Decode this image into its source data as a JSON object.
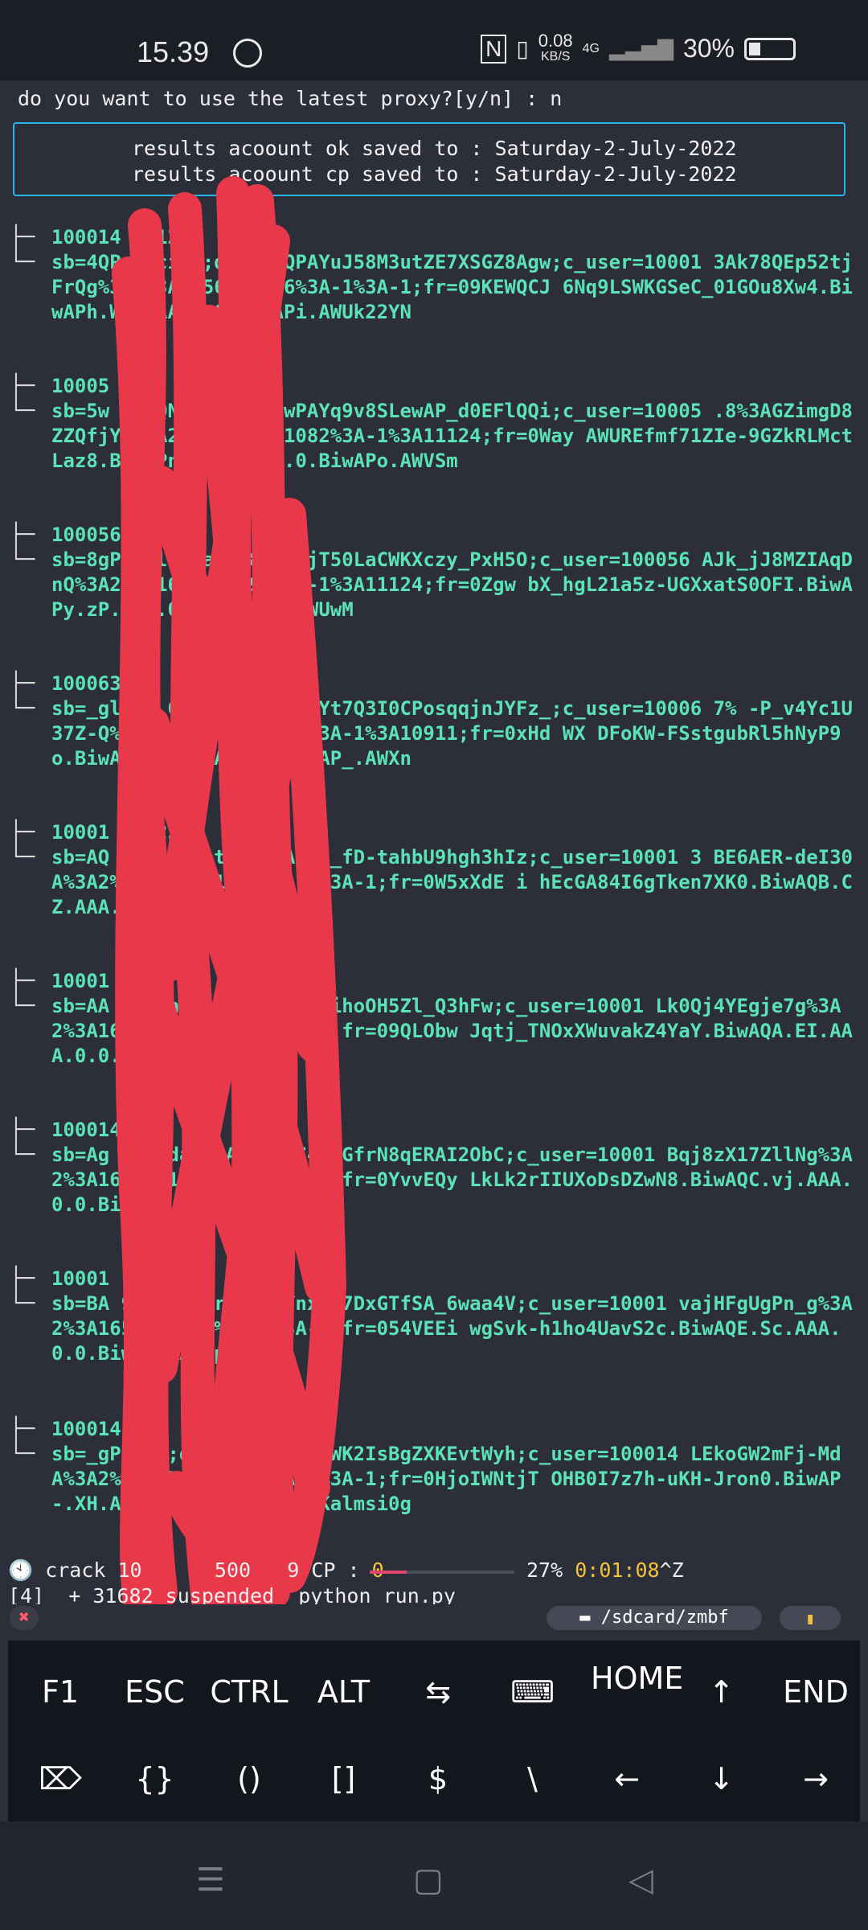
{
  "statusbar": {
    "time": "15.39",
    "whatsapp_icon": "whatsapp-icon",
    "nfc_icon": "nfc-icon",
    "vibrate_icon": "vibrate-icon",
    "net_speed_value": "0.08",
    "net_speed_unit": "KB/S",
    "network": "4G",
    "signal_icon": "signal-icon",
    "battery_pct": "30%",
    "battery_icon": "battery-icon"
  },
  "terminal": {
    "prompt": "do you want to use the latest proxy?[y/n] : n",
    "box": [
      "results acoount ok saved to : Saturday-2-July-2022",
      "results acoount cp saved to : Saturday-2-July-2022"
    ],
    "entries": [
      {
        "head": "100014                  ri123",
        "body": "sb=4QP                  UlciYT;datr=4QPAYuJ58M3utZE7XSGZ8Agw;c_user=10001                   3Ak78QEp52tjFrQg%3A2%3A1656751076%3A-1%3A-1;fr=09KEWQCJ                  6Nq9LSWKGSeC_01GOu8Xw4.BiwAPh.WF.AAA.0.0.BiwAPi.AWUk22YN"
      },
      {
        "head": "10005                  tri",
        "body": "sb=5w                  3mpQNBb;datr=5wPAYq9v8SLewAP_d0EFlQQi;c_user=10005                  .8%3AGZimgD8ZZQfjYw%3A2%3A1656751082%3A-1%3A11124;fr=0Way                  AWUREfmf71ZIe-9GZkRLMctLaz8.BiwAPn.Ap.AAA.0.0.BiwAPo.AWVSm"
      },
      {
        "head": "100056",
        "body": "sb=8gP                  DQlb;datr=8gPAYjT50LaCWKXczy_PxH5O;c_user=100056                  AJk_jJ8MZIAqDnQ%3A2%3A1656751093%3A-1%3A11124;fr=0Zgw                  bX_hgL21a5z-UGXxatS0OFI.BiwAPy.zP.AAA.0.0.BiwAPz.AWUwM"
      },
      {
        "head": "100063                  tr",
        "body": "sb=_gl                  HA  G0v;datr=_gPAYt7Q3I0CPosqqjnJYFz_;c_user=10006                  7%  -P_v4Yc1U37Z-Q%3A2%3A1656751105%3A-1%3A10911;fr=0xHd                  WX  DFoKW-FSstgubRl5hNyP9o.BiwAP-.WK.AAA.0.0.BiwAP_.AWXn"
      },
      {
        "head": "10001                  ri123",
        "body": "sb=AQ                  rVG5B;datr=AQTAYtC_fD-tahbU9hgh3hIz;c_user=10001                  3  BE6AER-deI30A%3A2%3A1656751107%3A-1%3A-1;fr=0W5xXdE                  i  hEcGA84I6gTken7XK0.BiwAQB.CZ.AAA.0.0.BiwAQG.AWU9vqt"
      },
      {
        "head": "10001                  3",
        "body": "sb=AA                  Vn;datr=AATAYr6uVaihoOH5Zl_Q3hFw;c_user=10001                  Lk0Qj4YEgje7g%3A2%3A1656751108%3A-1%3A-1;fr=09QLObw                  Jqtj_TNOxXWuvakZ4YaY.BiwAQA.EI.AAA.0.0.BiwAQC.AWXBgL0"
      },
      {
        "head": "100014                  23",
        "body": "sb=Ag                  6xI;datr=AgTAYvC4mbGfrN8qERAI2ObC;c_user=10001                  Bqj8zX17ZllNg%3A2%3A1656751109%3A-1%3A-1;fr=0YvvEQy                  LkLk2rIIUXoDsDZwN8.BiwAQC.vj.AAA.0.0.BiwAQD.AWW1PWT"
      },
      {
        "head": "10001                  ri123",
        "body": "sb=BA                  9HKq;datr=BATAYnxy17DxGTfSA_6waa4V;c_user=10001                  vajHFgUgPn_g%3A2%3A1656751111%3A-1%3A-1;fr=054VEEi                  wgSvk-h1ho4UavS2c.BiwAQE.Sc.AAA.0.0.BiwAQE.AWUpo3u"
      },
      {
        "head": "100014",
        "body": "sb=_gP                  bHP;datr=_gPAYthMWK2IsBgZXKEvtWyh;c_user=100014                  LEkoGW2mFj-MdA%3A2%3A1656751111%3A-1%3A-1;fr=0HjoIWNtjT                  OHB0I7z7h-uKH-Jron0.BiwAP-.XH.AAA.0.0.BiwAQF.AWVKalmsi0g"
      }
    ],
    "crack_prefix": "crack 10",
    "crack_mid": "500",
    "crack_ok": "9",
    "crack_cp_label": "CP :",
    "crack_cp": "0",
    "progress": 0.27,
    "progress_pct": "27%",
    "elapsed": "0:01:08",
    "ctrl_z": "^Z",
    "job_line": "[4]  + 31682 suspended  python run.py"
  },
  "tabs": {
    "close": "✖",
    "path": "/sdcard/zmbf",
    "bookmark_icon": "bookmark-icon"
  },
  "keys_row1": [
    "F1",
    "ESC",
    "CTRL",
    "ALT",
    "⇆",
    "⌨",
    "HOME",
    "↑",
    "END"
  ],
  "keys_row2": [
    "⌦",
    "{}",
    "()",
    "[]",
    "$",
    "\\",
    "←",
    "↓",
    "→"
  ],
  "nav": {
    "menu": "☰",
    "home": "▢",
    "back": "◁"
  },
  "colors": {
    "accent": "#27b6e8",
    "text_green": "#5be3b7",
    "scribble": "#e8384a",
    "progress": "#e24670",
    "yellow": "#f3c43a"
  }
}
